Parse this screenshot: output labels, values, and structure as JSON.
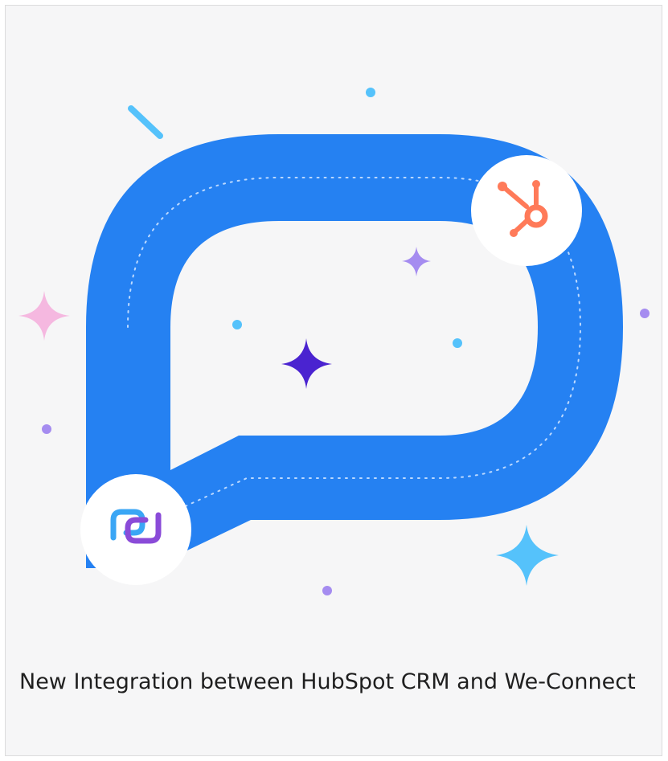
{
  "article": {
    "title": "New Integration between HubSpot CRM and We-Connect"
  },
  "colors": {
    "background": "#f6f6f7",
    "bubble_blue": "#2581f2",
    "hubspot_orange": "#ff7a59",
    "we_connect_blue": "#3aa6f5",
    "we_connect_purple": "#8a4bd8",
    "sparkle_pink": "#f5b8e0",
    "sparkle_indigo": "#4a23d0",
    "sparkle_lavender": "#a58cf0",
    "sparkle_cyan": "#55c2fb"
  },
  "icons": {
    "hubspot": "hubspot-logo",
    "we_connect": "we-connect-logo"
  }
}
